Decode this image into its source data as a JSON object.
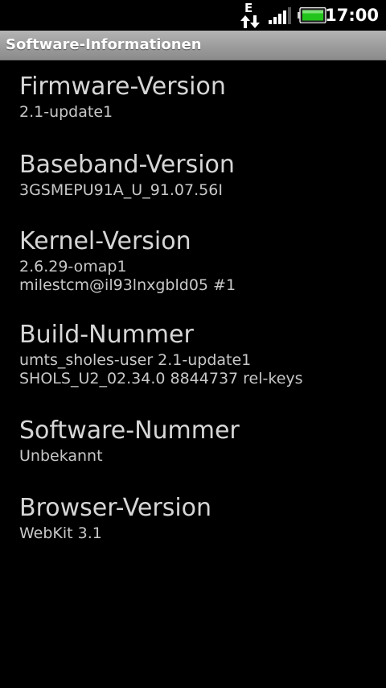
{
  "status_bar": {
    "network_type": "E",
    "time": "17:00",
    "icons": [
      "data-transfer-icon",
      "signal-strength-icon",
      "battery-icon"
    ],
    "battery_color": "#22c41c"
  },
  "title_bar": {
    "title": "Software-Informationen"
  },
  "items": [
    {
      "label": "Firmware-Version",
      "lines": [
        "2.1-update1"
      ]
    },
    {
      "label": "Baseband-Version",
      "lines": [
        "3GSMEPU91A_U_91.07.56I"
      ]
    },
    {
      "label": "Kernel-Version",
      "lines": [
        "2.6.29-omap1",
        "milestcm@il93lnxgbld05 #1"
      ]
    },
    {
      "label": "Build-Nummer",
      "lines": [
        "umts_sholes-user 2.1-update1",
        "SHOLS_U2_02.34.0 8844737 rel-keys"
      ]
    },
    {
      "label": "Software-Nummer",
      "lines": [
        "Unbekannt"
      ]
    },
    {
      "label": "Browser-Version",
      "lines": [
        "WebKit 3.1"
      ]
    }
  ]
}
